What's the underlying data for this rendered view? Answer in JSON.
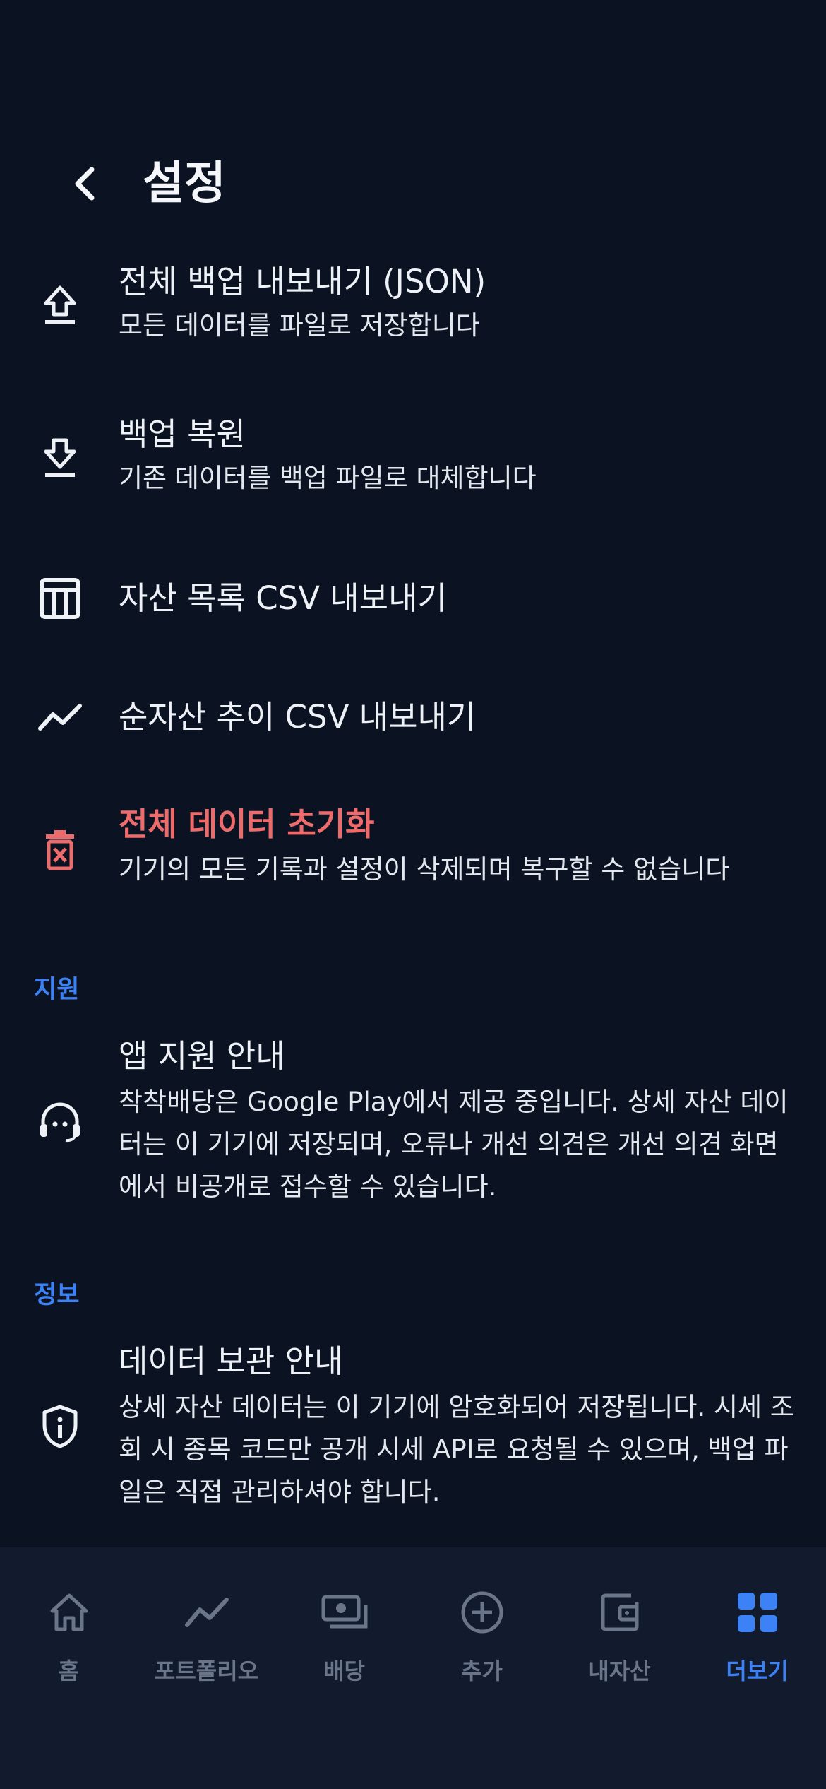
{
  "header": {
    "title": "설정"
  },
  "items": [
    {
      "title": "전체 백업 내보내기 (JSON)",
      "subtitle": "모든 데이터를 파일로 저장합니다"
    },
    {
      "title": "백업 복원",
      "subtitle": "기존 데이터를 백업 파일로 대체합니다"
    },
    {
      "title": "자산 목록 CSV 내보내기"
    },
    {
      "title": "순자산 추이 CSV 내보내기"
    },
    {
      "title": "전체 데이터 초기화",
      "subtitle": "기기의 모든 기록과 설정이 삭제되며 복구할 수 없습니다"
    }
  ],
  "support": {
    "label": "지원",
    "title": "앱 지원 안내",
    "subtitle": "착착배당은 Google Play에서 제공 중입니다. 상세 자산 데이터는 이 기기에 저장되며, 오류나 개선 의견은 개선 의견 화면에서 비공개로 접수할 수 있습니다."
  },
  "info": {
    "label": "정보",
    "title": "데이터 보관 안내",
    "subtitle": "상세 자산 데이터는 이 기기에 암호화되어 저장됩니다. 시세 조회 시 종목 코드만 공개 시세 API로 요청될 수 있으며, 백업 파일은 직접 관리하셔야 합니다."
  },
  "nav": [
    {
      "label": "홈",
      "icon": "home-icon"
    },
    {
      "label": "포트폴리오",
      "icon": "trend-icon"
    },
    {
      "label": "배당",
      "icon": "cash-icon"
    },
    {
      "label": "추가",
      "icon": "plus-circle-icon"
    },
    {
      "label": "내자산",
      "icon": "wallet-icon"
    },
    {
      "label": "더보기",
      "icon": "grid-icon",
      "active": true
    }
  ],
  "colors": {
    "background": "#0b1222",
    "accent": "#3c82f6",
    "danger": "#ee6b6b",
    "nav_bg": "#121a2e"
  }
}
